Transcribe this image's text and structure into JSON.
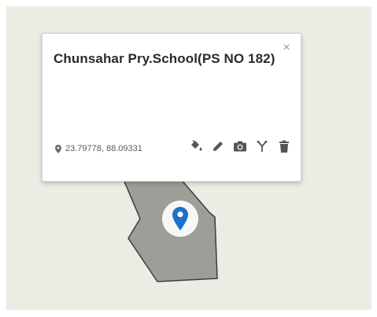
{
  "map": {
    "background_color": "#ecebe4",
    "parcel_fill": "#9e9e98",
    "parcel_stroke": "#3c3c3c"
  },
  "info_window": {
    "title": "Chunsahar Pry.School(PS NO 182)",
    "close_symbol": "×",
    "coordinates": "23.79778, 88.09331",
    "coordinate_icon": "location-pin-icon",
    "tools": [
      {
        "icon": "fill-color-icon"
      },
      {
        "icon": "pencil-edit-icon"
      },
      {
        "icon": "camera-icon"
      },
      {
        "icon": "fork-route-icon"
      },
      {
        "icon": "trash-delete-icon"
      }
    ]
  },
  "marker": {
    "icon": "map-pin-icon",
    "color": "#1a73c8"
  }
}
